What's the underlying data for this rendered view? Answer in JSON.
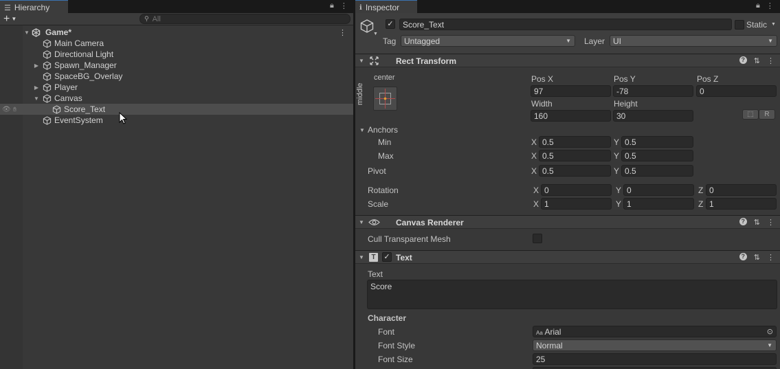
{
  "hierarchy": {
    "tab_label": "Hierarchy",
    "search_placeholder": "All",
    "scene": "Game*",
    "items": [
      {
        "label": "Main Camera"
      },
      {
        "label": "Directional Light"
      },
      {
        "label": "Spawn_Manager"
      },
      {
        "label": "SpaceBG_Overlay"
      },
      {
        "label": "Player"
      },
      {
        "label": "Canvas"
      },
      {
        "label": "Score_Text"
      },
      {
        "label": "EventSystem"
      }
    ]
  },
  "inspector": {
    "tab_label": "Inspector",
    "object_name": "Score_Text",
    "static_label": "Static",
    "tag_label": "Tag",
    "tag_value": "Untagged",
    "layer_label": "Layer",
    "layer_value": "UI",
    "rect_transform": {
      "title": "Rect Transform",
      "anchor_h": "center",
      "anchor_v": "middle",
      "pos_x_label": "Pos X",
      "pos_x": "97",
      "pos_y_label": "Pos Y",
      "pos_y": "-78",
      "pos_z_label": "Pos Z",
      "pos_z": "0",
      "width_label": "Width",
      "width": "160",
      "height_label": "Height",
      "height": "30",
      "r_button": "R",
      "anchors_label": "Anchors",
      "min_label": "Min",
      "min_x": "0.5",
      "min_y": "0.5",
      "max_label": "Max",
      "max_x": "0.5",
      "max_y": "0.5",
      "pivot_label": "Pivot",
      "pivot_x": "0.5",
      "pivot_y": "0.5",
      "rotation_label": "Rotation",
      "rot_x": "0",
      "rot_y": "0",
      "rot_z": "0",
      "scale_label": "Scale",
      "scale_x": "1",
      "scale_y": "1",
      "scale_z": "1",
      "x": "X",
      "y": "Y",
      "z": "Z"
    },
    "canvas_renderer": {
      "title": "Canvas Renderer",
      "cull_label": "Cull Transparent Mesh"
    },
    "text": {
      "title": "Text",
      "text_label": "Text",
      "text_value": "Score",
      "character_label": "Character",
      "font_label": "Font",
      "font_value": "Arial",
      "font_prefix": "Aa",
      "font_style_label": "Font Style",
      "font_style_value": "Normal",
      "font_size_label": "Font Size",
      "font_size_value": "25"
    }
  },
  "colors": {
    "background": "#383838",
    "selection": "#4d4d4d",
    "accent": "#3a72b0"
  }
}
